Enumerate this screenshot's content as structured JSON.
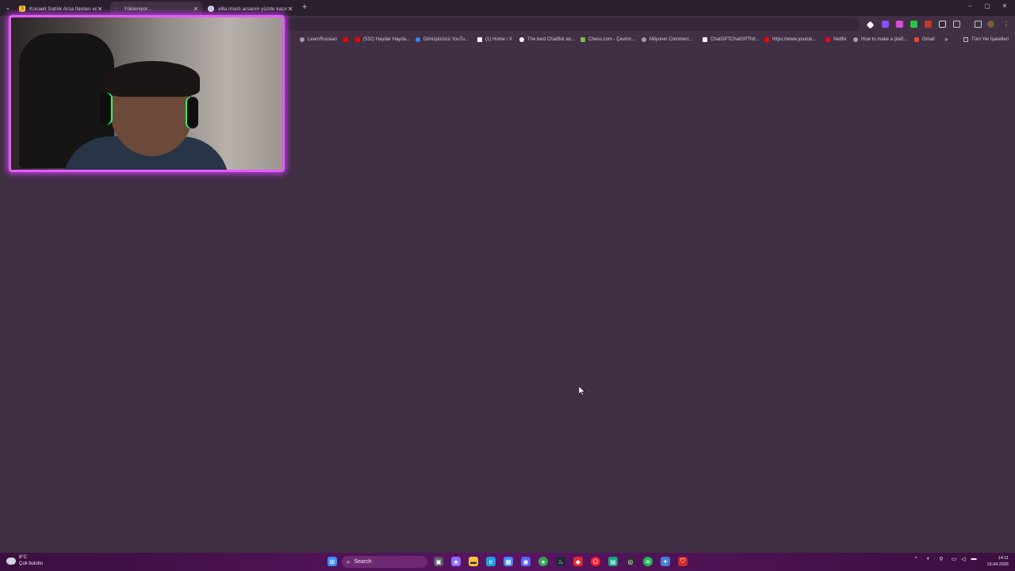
{
  "browser": {
    "tabs": [
      {
        "title": "Kocaeli Satılık Arsa İlanları ve F",
        "favicon_color": "#f7d21e",
        "favicon_glyph": "S",
        "active": false
      },
      {
        "title": "Yükleniyor...",
        "favicon_color": "#b7a9bb",
        "favicon_glyph": "◌",
        "active": true
      },
      {
        "title": "villa imarlı arsanın yüzde kaçın",
        "favicon_color": "#e5e5e5",
        "favicon_glyph": "G",
        "active": false
      }
    ],
    "new_tab_label": "+",
    "window_controls": {
      "minimize": "–",
      "maximize": "▢",
      "close": "✕"
    }
  },
  "bookmarks": [
    {
      "label": "LearnRussian",
      "icon_color": "#9aa0a6"
    },
    {
      "label": "",
      "icon_color": "#ff0000"
    },
    {
      "label": "(532) Haydar Hayda...",
      "icon_color": "#ff0000"
    },
    {
      "label": "Dönüştürücü YouTu...",
      "icon_color": "#4285f4"
    },
    {
      "label": "(1) Home / X",
      "icon_color": "#ffffff"
    },
    {
      "label": "The best ChatBot an...",
      "icon_color": "#ffffff"
    },
    {
      "label": "Chess.com - Çevrim...",
      "icon_color": "#81b64c"
    },
    {
      "label": "Milyoner Commerc...",
      "icon_color": "#9aa0a6"
    },
    {
      "label": "ChatGPTChatGPThtt...",
      "icon_color": "#ffffff"
    },
    {
      "label": "https://www.youtub...",
      "icon_color": "#ff0000"
    },
    {
      "label": "Netflix",
      "icon_color": "#e50914"
    },
    {
      "label": "How to make a platf...",
      "icon_color": "#9aa0a6"
    },
    {
      "label": "Gmail",
      "icon_color": "#ea4335"
    },
    {
      "label": "»",
      "icon_color": ""
    },
    {
      "label": "Tüm Yer İşaretleri",
      "icon_color": "#cdbfd0"
    }
  ],
  "taskbar": {
    "weather": {
      "temp": "8°C",
      "desc": "Çok bulutlu"
    },
    "search_label": "Search",
    "icons": [
      {
        "name": "start-icon",
        "color": "#3b8cff",
        "glyph": "⊞"
      },
      {
        "name": "task-view-icon",
        "color": "#5a5a6a",
        "glyph": "▣"
      },
      {
        "name": "copilot-icon",
        "color": "#8a6cff",
        "glyph": "◈"
      },
      {
        "name": "file-explorer-icon",
        "color": "#f5c542",
        "glyph": "▬"
      },
      {
        "name": "edge-icon",
        "color": "#1fa0e0",
        "glyph": "e"
      },
      {
        "name": "store-icon",
        "color": "#3b8cff",
        "glyph": "▦"
      },
      {
        "name": "discord-icon",
        "color": "#5865f2",
        "glyph": "◉"
      },
      {
        "name": "chrome-icon",
        "color": "#34a853",
        "glyph": "●"
      },
      {
        "name": "steam-icon",
        "color": "#1b2838",
        "glyph": "♨"
      },
      {
        "name": "app-red-icon",
        "color": "#e0282e",
        "glyph": "◆"
      },
      {
        "name": "opera-icon",
        "color": "#ff1b2d",
        "glyph": "O"
      },
      {
        "name": "app-green-icon",
        "color": "#15a37f",
        "glyph": "▤"
      },
      {
        "name": "obs-icon",
        "color": "#302e31",
        "glyph": "◎"
      },
      {
        "name": "spotify-icon",
        "color": "#1db954",
        "glyph": "≋"
      },
      {
        "name": "settings-app-icon",
        "color": "#4a7bd6",
        "glyph": "✦"
      },
      {
        "name": "security-app-icon",
        "color": "#d12a2a",
        "glyph": "⛉"
      }
    ],
    "clock": {
      "time": "14:11",
      "date": "19.04.2026"
    }
  }
}
